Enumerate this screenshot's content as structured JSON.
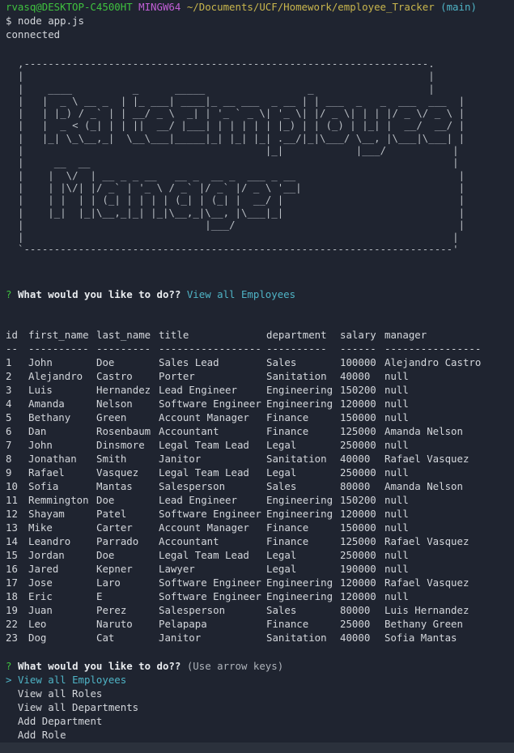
{
  "prompt": {
    "user_host": "rvasq@DESKTOP-C4500HT",
    "shell": "MINGW64",
    "path": "~/Documents/UCF/Homework/employee_Tracker",
    "branch": "(main)",
    "command": "$ node app.js",
    "output": "connected"
  },
  "banner": {
    "text": ",-------------------------------------------------------------------.\n|                                                                   |\n|    ____          _      _____                 _                   |\n|   |  _ \\ __ _  | |_ ___| ____|_ __ ___  _ __ | | ___  _   _  ___  ___  |\n|   | |_) / _` | | __/ _ \\  _| | '_ ` _ \\| '_ \\| |/ _ \\| | | |/ _ \\/ _ \\ |\n|   |  _ < (_| | | ||  __/ |___| | | | | | |_) | | (_) | |_| |  __/  __/ |\n|   |_| \\_\\__,_|  \\__\\___|_____|_| |_| |_| .__/|_|\\___/ \\__, |\\___|\\___| |\n|                                        |_|            |___/           |\n|     __  __                                                            |\n|    |  \\/  | __ _ _ __   __ _  __ _  ___ _ __                           |\n|    | |\\/| |/ _` | '_ \\ / _` |/ _` |/ _ \\ '__|                          |\n|    | |  | | (_| | | | | (_| | (_| |  __/ |                             |\n|    |_|  |_|\\__,_|_| |_|\\__,_|\\__, |\\___|_|                             |\n|                              |___/                                     |\n|                                                                       |\n`-----------------------------------------------------------------------'"
  },
  "question1": {
    "mark": "?",
    "text": "What would you like to do??",
    "answer": "View all Employees"
  },
  "table": {
    "headers": [
      "id",
      "first_name",
      "last_name",
      "title",
      "department",
      "salary",
      "manager"
    ],
    "dividers": [
      "--",
      "----------",
      "---------",
      "-----------------",
      "----------",
      "------",
      "----------------"
    ],
    "rows": [
      [
        "1",
        "John",
        "Doe",
        "Sales Lead",
        "Sales",
        "100000",
        "Alejandro Castro"
      ],
      [
        "2",
        "Alejandro",
        "Castro",
        "Porter",
        "Sanitation",
        "40000",
        "null"
      ],
      [
        "3",
        "Luis",
        "Hernandez",
        "Lead Engineer",
        "Engineering",
        "150200",
        "null"
      ],
      [
        "4",
        "Amanda",
        "Nelson",
        "Software Engineer",
        "Engineering",
        "120000",
        "null"
      ],
      [
        "5",
        "Bethany",
        "Green",
        "Account Manager",
        "Finance",
        "150000",
        "null"
      ],
      [
        "6",
        "Dan",
        "Rosenbaum",
        "Accountant",
        "Finance",
        "125000",
        "Amanda Nelson"
      ],
      [
        "7",
        "John",
        "Dinsmore",
        "Legal Team Lead",
        "Legal",
        "250000",
        "null"
      ],
      [
        "8",
        "Jonathan",
        "Smith",
        "Janitor",
        "Sanitation",
        "40000",
        "Rafael Vasquez"
      ],
      [
        "9",
        "Rafael",
        "Vasquez",
        "Legal Team Lead",
        "Legal",
        "250000",
        "null"
      ],
      [
        "10",
        "Sofia",
        "Mantas",
        "Salesperson",
        "Sales",
        "80000",
        "Amanda Nelson"
      ],
      [
        "11",
        "Remmington",
        "Doe",
        "Lead Engineer",
        "Engineering",
        "150200",
        "null"
      ],
      [
        "12",
        "Shayam",
        "Patel",
        "Software Engineer",
        "Engineering",
        "120000",
        "null"
      ],
      [
        "13",
        "Mike",
        "Carter",
        "Account Manager",
        "Finance",
        "150000",
        "null"
      ],
      [
        "14",
        "Leandro",
        "Parrado",
        "Accountant",
        "Finance",
        "125000",
        "Rafael Vasquez"
      ],
      [
        "15",
        "Jordan",
        "Doe",
        "Legal Team Lead",
        "Legal",
        "250000",
        "null"
      ],
      [
        "16",
        "Jared",
        "Kepner",
        "Lawyer",
        "Legal",
        "190000",
        "null"
      ],
      [
        "17",
        "Jose",
        "Laro",
        "Software Engineer",
        "Engineering",
        "120000",
        "Rafael Vasquez"
      ],
      [
        "18",
        "Eric",
        "E",
        "Software Engineer",
        "Engineering",
        "120000",
        "null"
      ],
      [
        "19",
        "Juan",
        "Perez",
        "Salesperson",
        "Sales",
        "80000",
        "Luis Hernandez"
      ],
      [
        "22",
        "Leo",
        "Naruto",
        "Pelapapa",
        "Finance",
        "25000",
        "Bethany Green"
      ],
      [
        "23",
        "Dog",
        "Cat",
        "Janitor",
        "Sanitation",
        "40000",
        "Sofia Mantas"
      ]
    ]
  },
  "question2": {
    "mark": "?",
    "text": "What would you like to do??",
    "hint": "(Use arrow keys)"
  },
  "menu": {
    "pointer": ">",
    "items": [
      "View all Employees",
      "View all Roles",
      "View all Departments",
      "Add Department",
      "Add Role"
    ]
  },
  "colors": {
    "background": "#1f2430",
    "green": "#3fc13f",
    "magenta": "#c15fd6",
    "yellow": "#c9b64d",
    "cyan": "#4fb4c6"
  }
}
